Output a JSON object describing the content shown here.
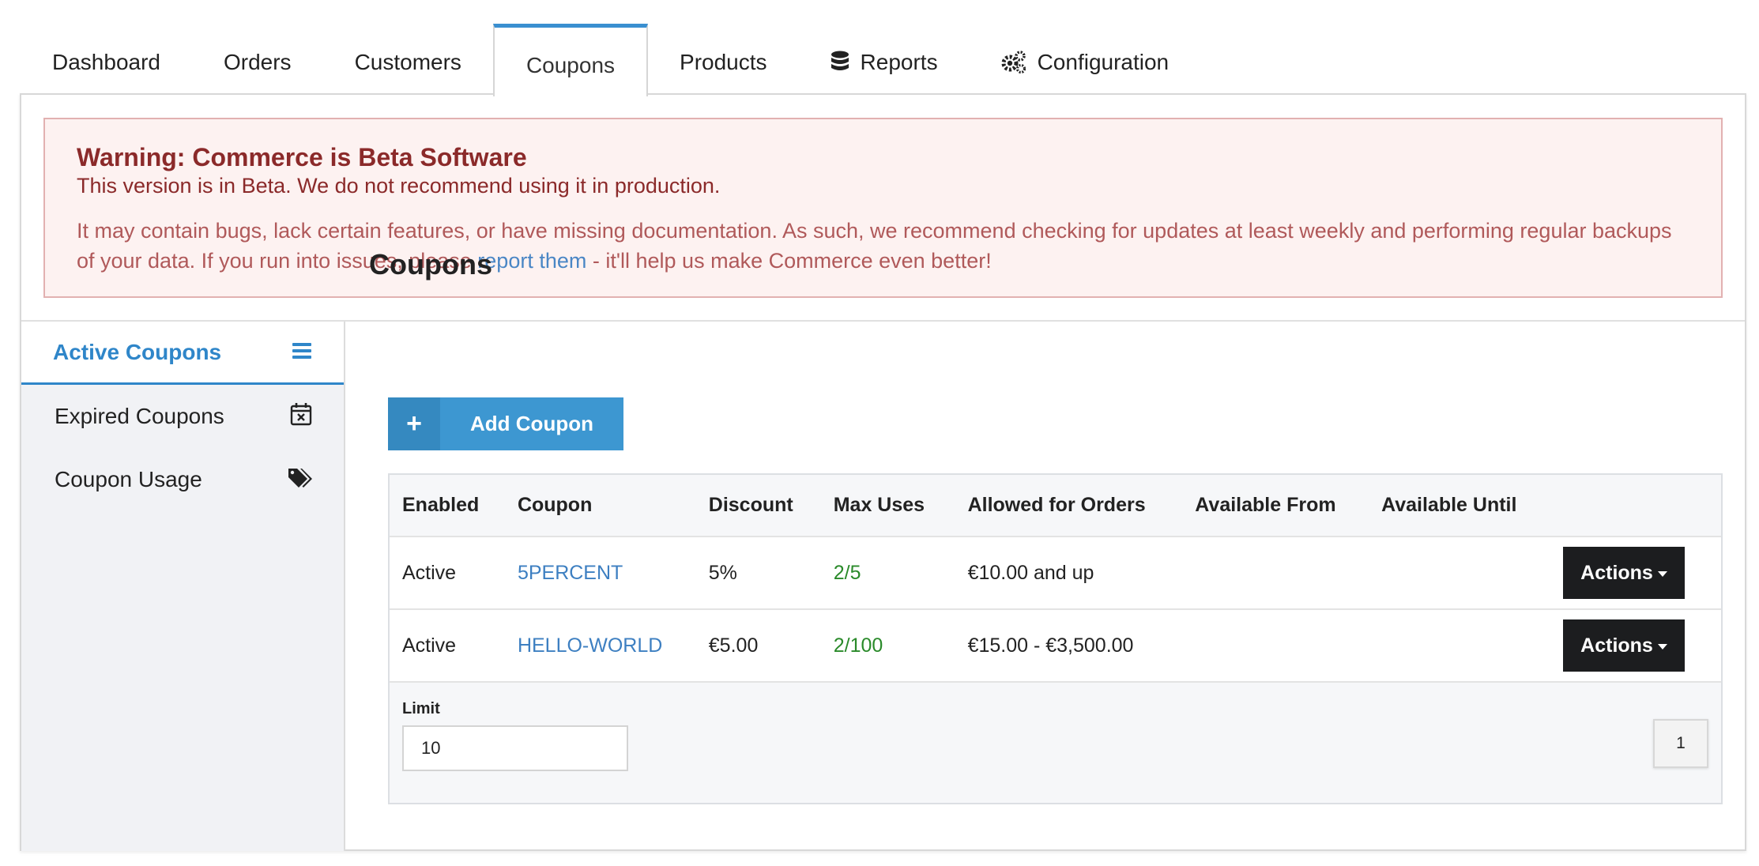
{
  "tabs": [
    {
      "label": "Dashboard",
      "icon": ""
    },
    {
      "label": "Orders",
      "icon": ""
    },
    {
      "label": "Customers",
      "icon": ""
    },
    {
      "label": "Coupons",
      "icon": "",
      "active": true
    },
    {
      "label": "Products",
      "icon": ""
    },
    {
      "label": "Reports",
      "icon": "database-icon"
    },
    {
      "label": "Configuration",
      "icon": "gears-icon"
    }
  ],
  "warning": {
    "title": "Warning: Commerce is Beta Software",
    "subtitle": "This version is in Beta. We do not recommend using it in production.",
    "body_before": "It may contain bugs, lack certain features, or have missing documentation. As such, we recommend checking for updates at least weekly and performing regular backups of your data. If you run into issues, please ",
    "link_text": "report them",
    "body_after": " - it'll help us make Commerce even better!"
  },
  "sidebar": {
    "items": [
      {
        "label": "Active Coupons",
        "icon": "list-icon"
      },
      {
        "label": "Expired Coupons",
        "icon": "calendar-x-icon"
      },
      {
        "label": "Coupon Usage",
        "icon": "tags-icon"
      }
    ]
  },
  "main": {
    "title": "Coupons",
    "add_button": {
      "icon": "+",
      "label": "Add Coupon"
    }
  },
  "table": {
    "headers": [
      "Enabled",
      "Coupon",
      "Discount",
      "Max Uses",
      "Allowed for Orders",
      "Available From",
      "Available Until",
      ""
    ],
    "rows": [
      {
        "enabled": "Active",
        "coupon": "5PERCENT",
        "discount": "5%",
        "max_uses": "2/5",
        "allowed": "€10.00 and up",
        "from": "",
        "until": "",
        "actions": "Actions"
      },
      {
        "enabled": "Active",
        "coupon": "HELLO-WORLD",
        "discount": "€5.00",
        "max_uses": "2/100",
        "allowed": "€15.00 - €3,500.00",
        "from": "",
        "until": "",
        "actions": "Actions"
      }
    ]
  },
  "footer": {
    "limit_label": "Limit",
    "limit_value": "10",
    "page": "1"
  },
  "colors": {
    "accent": "#3a8fd0",
    "warning_title": "#8b2a2a",
    "warning_bg": "#fdf2f1",
    "link": "#3d7fc1",
    "uses_green": "#2a8a2a",
    "actions_bg": "#1c1d1f"
  }
}
